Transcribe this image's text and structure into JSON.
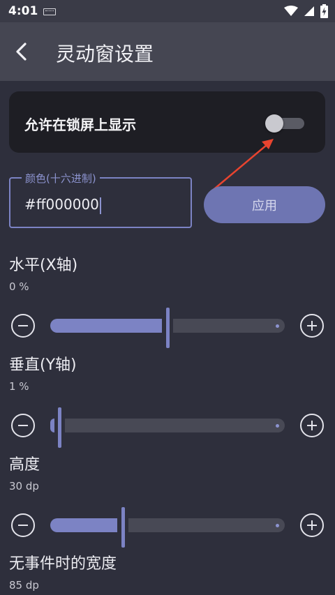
{
  "status": {
    "time": "4:01"
  },
  "appbar": {
    "title": "灵动窗设置"
  },
  "lockscreen": {
    "label": "允许在锁屏上显示",
    "enabled": false
  },
  "color": {
    "label": "颜色(十六进制)",
    "hash": "#",
    "value": "ff000000",
    "apply_label": "应用"
  },
  "sliders": [
    {
      "title": "水平(X轴)",
      "value_text": "0 %",
      "fraction": 0.5
    },
    {
      "title": "垂直(Y轴)",
      "value_text": "1 %",
      "fraction": 0.04
    },
    {
      "title": "高度",
      "value_text": "30 dp",
      "fraction": 0.31
    }
  ],
  "partial": {
    "title": "无事件时的宽度",
    "value_text": "85 dp"
  },
  "colors": {
    "accent": "#7c83c4",
    "annotation_arrow": "#e8442f"
  }
}
